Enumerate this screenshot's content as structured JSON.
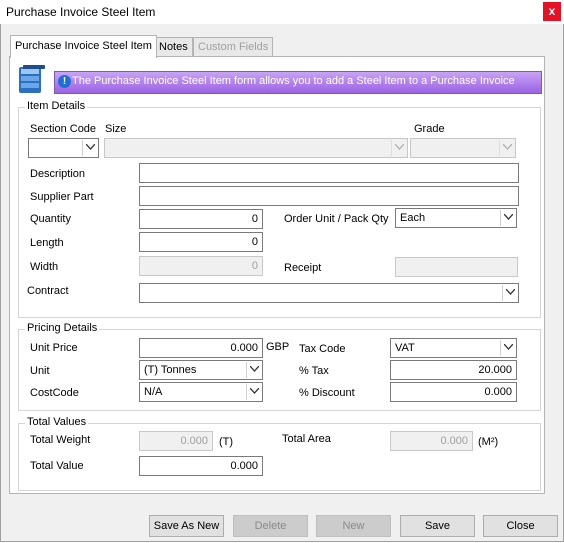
{
  "window": {
    "title": "Purchase Invoice Steel Item",
    "close_glyph": "x"
  },
  "tabs": [
    {
      "label": "Purchase Invoice Steel Item",
      "state": "active"
    },
    {
      "label": "Notes",
      "state": "normal"
    },
    {
      "label": "Custom Fields",
      "state": "disabled"
    }
  ],
  "banner": {
    "text": "The Purchase Invoice Steel Item form allows you to add a Steel Item to a Purchase Invoice",
    "icon": "info-icon"
  },
  "item_details": {
    "title": "Item Details",
    "section_code_label": "Section Code",
    "size_label": "Size",
    "grade_label": "Grade",
    "description_label": "Description",
    "supplier_part_label": "Supplier Part",
    "quantity_label": "Quantity",
    "quantity_value": "0",
    "order_unit_label": "Order Unit / Pack Qty",
    "order_unit_value": "Each",
    "length_label": "Length",
    "length_value": "0",
    "width_label": "Width",
    "width_value": "0",
    "receipt_label": "Receipt",
    "contract_label": "Contract"
  },
  "pricing_details": {
    "title": "Pricing Details",
    "unit_price_label": "Unit Price",
    "unit_price_value": "0.000",
    "currency": "GBP",
    "tax_code_label": "Tax Code",
    "tax_code_value": "VAT",
    "unit_label": "Unit",
    "unit_value": "(T) Tonnes",
    "pct_tax_label": "% Tax",
    "pct_tax_value": "20.000",
    "cost_code_label": "CostCode",
    "cost_code_value": "N/A",
    "pct_discount_label": "% Discount",
    "pct_discount_value": "0.000"
  },
  "total_values": {
    "title": "Total Values",
    "total_weight_label": "Total Weight",
    "total_weight_value": "0.000",
    "total_weight_unit": "(T)",
    "total_area_label": "Total Area",
    "total_area_value": "0.000",
    "total_area_unit": "(M²)",
    "total_value_label": "Total Value",
    "total_value_value": "0.000"
  },
  "buttons": {
    "save_as_new": "Save As New",
    "delete": "Delete",
    "new": "New",
    "save": "Save",
    "close": "Close"
  }
}
